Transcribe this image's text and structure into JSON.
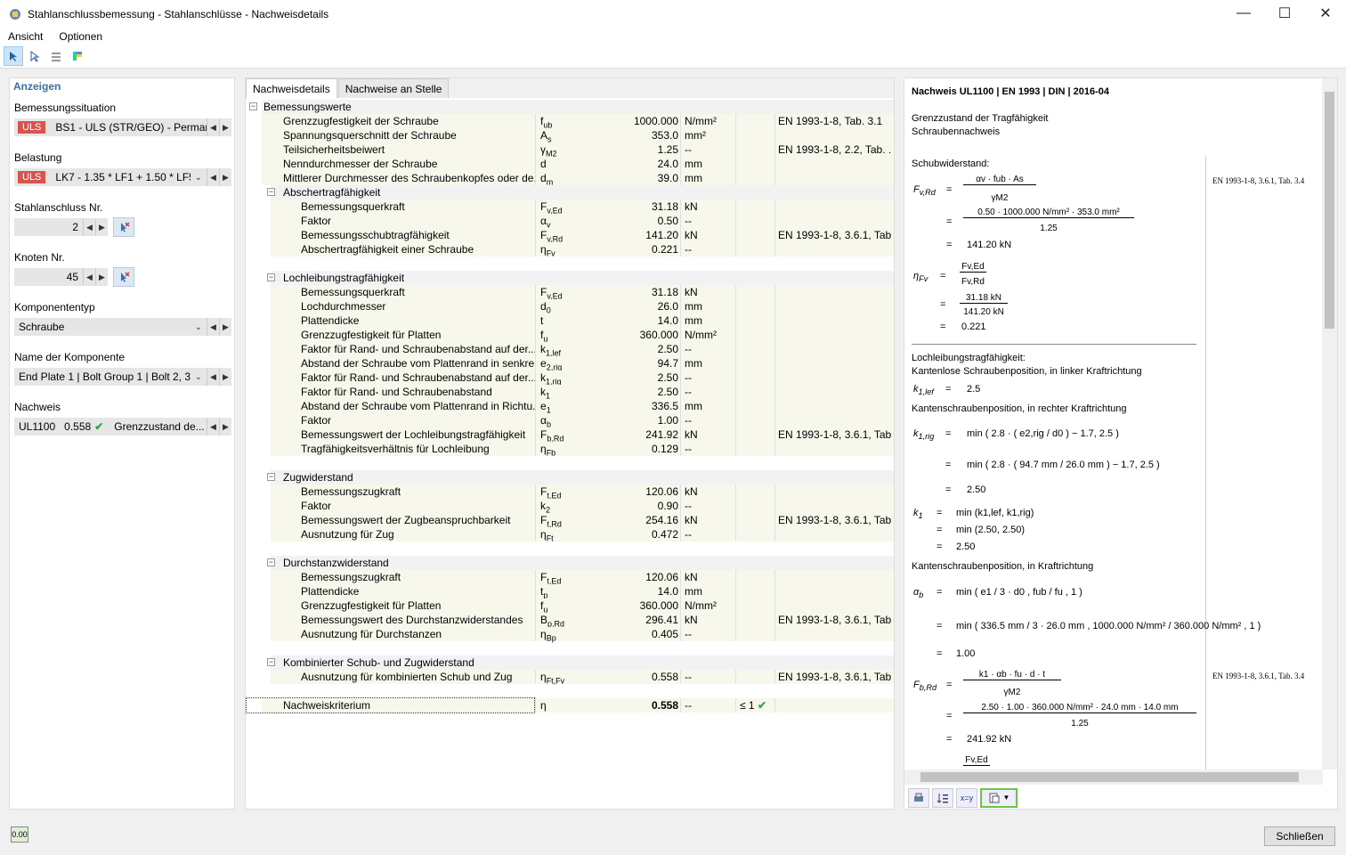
{
  "window": {
    "title": "Stahlanschlussbemessung - Stahlanschlüsse - Nachweisdetails"
  },
  "menu": [
    "Ansicht",
    "Optionen"
  ],
  "left": {
    "header": "Anzeigen",
    "bemessungssituation_label": "Bemessungssituation",
    "bemessungssituation_tag": "ULS",
    "bemessungssituation_value": "BS1 - ULS (STR/GEO) - Permane...",
    "belastung_label": "Belastung",
    "belastung_tag": "ULS",
    "belastung_value": "LK7 - 1.35 * LF1 + 1.50 * LF5 ...",
    "anschluss_label": "Stahlanschluss Nr.",
    "anschluss_value": "2",
    "knoten_label": "Knoten Nr.",
    "knoten_value": "45",
    "komponententyp_label": "Komponententyp",
    "komponententyp_value": "Schraube",
    "komponente_label": "Name der Komponente",
    "komponente_value": "End Plate 1 | Bolt Group 1 | Bolt 2, 3",
    "nachweis_label": "Nachweis",
    "nachweis_id": "UL1100",
    "nachweis_ratio": "0.558",
    "nachweis_desc": "Grenzzustand de..."
  },
  "tabs": [
    "Nachweisdetails",
    "Nachweise an Stelle"
  ],
  "rows": [
    {
      "level": 0,
      "name": "Bemessungswerte",
      "group": true
    },
    {
      "level": 1,
      "name": "Grenzzugfestigkeit der Schraube",
      "sym": "fub",
      "val": "1000.000",
      "unit": "N/mm²",
      "ref": "EN 1993-1-8, Tab. 3.1"
    },
    {
      "level": 1,
      "name": "Spannungsquerschnitt der Schraube",
      "sym": "As",
      "val": "353.0",
      "unit": "mm²",
      "ref": ""
    },
    {
      "level": 1,
      "name": "Teilsicherheitsbeiwert",
      "sym": "γM2",
      "val": "1.25",
      "unit": "--",
      "ref": "EN 1993-1-8, 2.2, Tab. ..."
    },
    {
      "level": 1,
      "name": "Nenndurchmesser der Schraube",
      "sym": "d",
      "val": "24.0",
      "unit": "mm",
      "ref": ""
    },
    {
      "level": 1,
      "name": "Mittlerer Durchmesser des Schraubenkopfes oder de...",
      "sym": "dm",
      "val": "39.0",
      "unit": "mm",
      "ref": ""
    },
    {
      "level": 1,
      "name": "Abschertragfähigkeit",
      "group": true
    },
    {
      "level": 2,
      "name": "Bemessungsquerkraft",
      "sym": "Fv,Ed",
      "val": "31.18",
      "unit": "kN",
      "ref": ""
    },
    {
      "level": 2,
      "name": "Faktor",
      "sym": "αv",
      "val": "0.50",
      "unit": "--",
      "ref": ""
    },
    {
      "level": 2,
      "name": "Bemessungsschubtragfähigkeit",
      "sym": "Fv,Rd",
      "val": "141.20",
      "unit": "kN",
      "ref": "EN 1993-1-8, 3.6.1, Tab..."
    },
    {
      "level": 2,
      "name": "Abschertragfähigkeit einer Schraube",
      "sym": "ηFv",
      "val": "0.221",
      "unit": "--",
      "ref": ""
    },
    {
      "blank": true
    },
    {
      "level": 1,
      "name": "Lochleibungstragfähigkeit",
      "group": true
    },
    {
      "level": 2,
      "name": "Bemessungsquerkraft",
      "sym": "Fv,Ed",
      "val": "31.18",
      "unit": "kN",
      "ref": ""
    },
    {
      "level": 2,
      "name": "Lochdurchmesser",
      "sym": "d0",
      "val": "26.0",
      "unit": "mm",
      "ref": ""
    },
    {
      "level": 2,
      "name": "Plattendicke",
      "sym": "t",
      "val": "14.0",
      "unit": "mm",
      "ref": ""
    },
    {
      "level": 2,
      "name": "Grenzzugfestigkeit für Platten",
      "sym": "fu",
      "val": "360.000",
      "unit": "N/mm²",
      "ref": ""
    },
    {
      "level": 2,
      "name": "Faktor für Rand- und Schraubenabstand auf der...",
      "sym": "k1,lef",
      "val": "2.50",
      "unit": "--",
      "ref": ""
    },
    {
      "level": 2,
      "name": "Abstand der Schraube vom Plattenrand in senkre...",
      "sym": "e2,rig",
      "val": "94.7",
      "unit": "mm",
      "ref": ""
    },
    {
      "level": 2,
      "name": "Faktor für Rand- und Schraubenabstand auf der...",
      "sym": "k1,rig",
      "val": "2.50",
      "unit": "--",
      "ref": ""
    },
    {
      "level": 2,
      "name": "Faktor für Rand- und Schraubenabstand",
      "sym": "k1",
      "val": "2.50",
      "unit": "--",
      "ref": ""
    },
    {
      "level": 2,
      "name": "Abstand der Schraube vom Plattenrand in Richtu...",
      "sym": "e1",
      "val": "336.5",
      "unit": "mm",
      "ref": ""
    },
    {
      "level": 2,
      "name": "Faktor",
      "sym": "αb",
      "val": "1.00",
      "unit": "--",
      "ref": ""
    },
    {
      "level": 2,
      "name": "Bemessungswert der Lochleibungstragfähigkeit",
      "sym": "Fb,Rd",
      "val": "241.92",
      "unit": "kN",
      "ref": "EN 1993-1-8, 3.6.1, Tab..."
    },
    {
      "level": 2,
      "name": "Tragfähigkeitsverhältnis für Lochleibung",
      "sym": "ηFb",
      "val": "0.129",
      "unit": "--",
      "ref": ""
    },
    {
      "blank": true
    },
    {
      "level": 1,
      "name": "Zugwiderstand",
      "group": true
    },
    {
      "level": 2,
      "name": "Bemessungszugkraft",
      "sym": "Ft,Ed",
      "val": "120.06",
      "unit": "kN",
      "ref": ""
    },
    {
      "level": 2,
      "name": "Faktor",
      "sym": "k2",
      "val": "0.90",
      "unit": "--",
      "ref": ""
    },
    {
      "level": 2,
      "name": "Bemessungswert der Zugbeanspruchbarkeit",
      "sym": "Ft,Rd",
      "val": "254.16",
      "unit": "kN",
      "ref": "EN 1993-1-8, 3.6.1, Tab..."
    },
    {
      "level": 2,
      "name": "Ausnutzung für Zug",
      "sym": "ηFt",
      "val": "0.472",
      "unit": "--",
      "ref": ""
    },
    {
      "blank": true
    },
    {
      "level": 1,
      "name": "Durchstanzwiderstand",
      "group": true
    },
    {
      "level": 2,
      "name": "Bemessungszugkraft",
      "sym": "Ft,Ed",
      "val": "120.06",
      "unit": "kN",
      "ref": ""
    },
    {
      "level": 2,
      "name": "Plattendicke",
      "sym": "tp",
      "val": "14.0",
      "unit": "mm",
      "ref": ""
    },
    {
      "level": 2,
      "name": "Grenzzugfestigkeit für Platten",
      "sym": "fu",
      "val": "360.000",
      "unit": "N/mm²",
      "ref": ""
    },
    {
      "level": 2,
      "name": "Bemessungswert des Durchstanzwiderstandes",
      "sym": "Bp,Rd",
      "val": "296.41",
      "unit": "kN",
      "ref": "EN 1993-1-8, 3.6.1, Tab..."
    },
    {
      "level": 2,
      "name": "Ausnutzung für Durchstanzen",
      "sym": "ηBp",
      "val": "0.405",
      "unit": "--",
      "ref": ""
    },
    {
      "blank": true
    },
    {
      "level": 1,
      "name": "Kombinierter Schub- und Zugwiderstand",
      "group": true
    },
    {
      "level": 2,
      "name": "Ausnutzung für kombinierten Schub und Zug",
      "sym": "ηFt,Fv",
      "val": "0.558",
      "unit": "--",
      "ref": "EN 1993-1-8, 3.6.1, Tab..."
    },
    {
      "blank": true
    },
    {
      "level": 1,
      "name": "Nachweiskriterium",
      "sym": "η",
      "val": "0.558",
      "unit": "--",
      "crit": "≤ 1",
      "final": true
    }
  ],
  "right": {
    "title": "Nachweis UL1100 | EN 1993 | DIN | 2016-04",
    "line1": "Grenzzustand der Tragfähigkeit",
    "line2": "Schraubennachweis",
    "schub": "Schubwiderstand:",
    "ref1": "EN 1993-1-8, 3.6.1, Tab. 3.4",
    "fvrd_num": "αv · fub · As",
    "fvrd_den": "γM2",
    "fvrd_num2": "0.50 · 1000.000 N/mm² · 353.0 mm²",
    "fvrd_den2": "1.25",
    "fvrd_res": "141.20 kN",
    "eta_num": "Fv,Ed",
    "eta_den": "Fv,Rd",
    "eta_num2": "31.18 kN",
    "eta_den2": "141.20 kN",
    "eta_res": "0.221",
    "loch": "Lochleibungstragfähigkeit:",
    "loch2": "Kantenlose Schraubenposition, in linker Kraftrichtung",
    "k1lef": "2.5",
    "kanten1": "Kantenschraubenposition, in rechter Kraftrichtung",
    "k1rig_1": "min ( 2.8 · ( e2,rig / d0 ) − 1.7, 2.5 )",
    "k1rig_2": "min ( 2.8 · ( 94.7 mm / 26.0 mm ) − 1.7, 2.5 )",
    "k1rig_res": "2.50",
    "k1_1": "min (k1,lef, k1,rig)",
    "k1_2": "min (2.50, 2.50)",
    "k1_res": "2.50",
    "kanten2": "Kantenschraubenposition, in Kraftrichtung",
    "ab_1": "min ( e1 / 3 · d0 , fub / fu , 1 )",
    "ab_2": "min ( 336.5 mm / 3 · 26.0 mm , 1000.000 N/mm² / 360.000 N/mm² , 1 )",
    "ab_res": "1.00",
    "ref2": "EN 1993-1-8, 3.6.1, Tab. 3.4",
    "fbrd_num": "k1 · αb · fu · d · t",
    "fbrd_den": "γM2",
    "fbrd_num2": "2.50 · 1.00 · 360.000 N/mm² · 24.0 mm · 14.0 mm",
    "fbrd_den2": "1.25",
    "fbrd_res": "241.92 kN",
    "last": "Fv,Ed"
  },
  "close_label": "Schließen",
  "status_icon": "0.00"
}
